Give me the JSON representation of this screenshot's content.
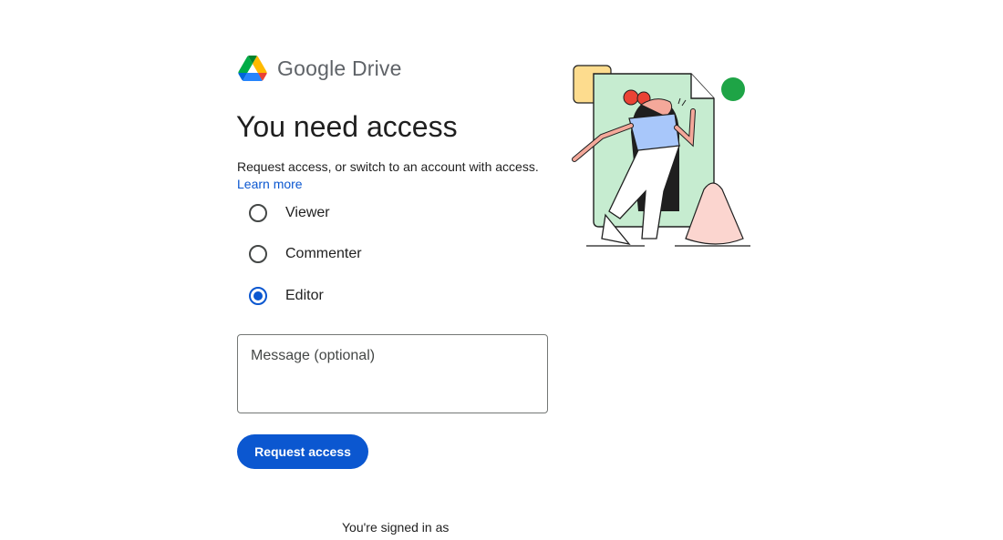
{
  "app": {
    "name": "Google Drive",
    "logo_icon": "google-drive-logo-icon"
  },
  "page": {
    "title": "You need access",
    "subtitle": "Request access, or switch to an account with access.",
    "learn_more": "Learn more"
  },
  "roles": [
    {
      "label": "Viewer",
      "selected": false
    },
    {
      "label": "Commenter",
      "selected": false
    },
    {
      "label": "Editor",
      "selected": true
    }
  ],
  "message": {
    "placeholder": "Message (optional)",
    "value": ""
  },
  "request_button": {
    "label": "Request access"
  },
  "footer": {
    "signed_in_text": "You're signed in as"
  },
  "colors": {
    "accent": "#0b57d0",
    "text": "#1f1f1f",
    "border": "#747775"
  }
}
